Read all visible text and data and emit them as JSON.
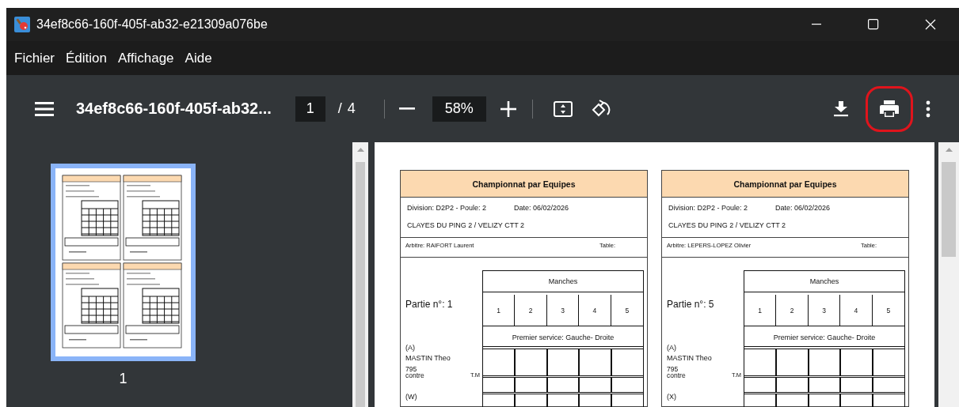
{
  "window": {
    "title": "34ef8c66-160f-405f-ab32-e21309a076be"
  },
  "menu": [
    "Fichier",
    "Édition",
    "Affichage",
    "Aide"
  ],
  "toolbar": {
    "document_title": "34ef8c66-160f-405f-ab32...",
    "page_current": "1",
    "page_separator": "/",
    "page_total": "4",
    "zoom": "58%",
    "print_button": {
      "highlighted": true
    }
  },
  "sidebar": {
    "thumbnails": [
      {
        "label": "1",
        "selected": true
      }
    ]
  },
  "cards": [
    {
      "title": "Championnat par Equipes",
      "division": "Division: D2P2 - Poule: 2",
      "date": "Date: 06/02/2026",
      "teams": "CLAYES DU PING 2 / VELIZY CTT 2",
      "referee": "Arbitre: RAIFORT Laurent",
      "table_label": "Table:",
      "match": "Partie n°: 1",
      "sets_label": "Manches",
      "set_numbers": [
        "1",
        "2",
        "3",
        "4",
        "5"
      ],
      "service": "Premier service: Gauche- Droite",
      "player_a": {
        "tag": "(A)",
        "name": "MASTIN Theo",
        "points": "795",
        "against": "contre",
        "tm": "T.M"
      },
      "player_b_tag": "(W)"
    },
    {
      "title": "Championnat par Equipes",
      "division": "Division: D2P2 - Poule: 2",
      "date": "Date: 06/02/2026",
      "teams": "CLAYES DU PING 2 / VELIZY CTT 2",
      "referee": "Arbitre: LEPERS-LOPEZ Olivier",
      "table_label": "Table:",
      "match": "Partie n°: 5",
      "sets_label": "Manches",
      "set_numbers": [
        "1",
        "2",
        "3",
        "4",
        "5"
      ],
      "service": "Premier service: Gauche- Droite",
      "player_a": {
        "tag": "(A)",
        "name": "MASTIN Theo",
        "points": "795",
        "against": "contre",
        "tm": "T.M"
      },
      "player_b_tag": "(X)"
    }
  ]
}
